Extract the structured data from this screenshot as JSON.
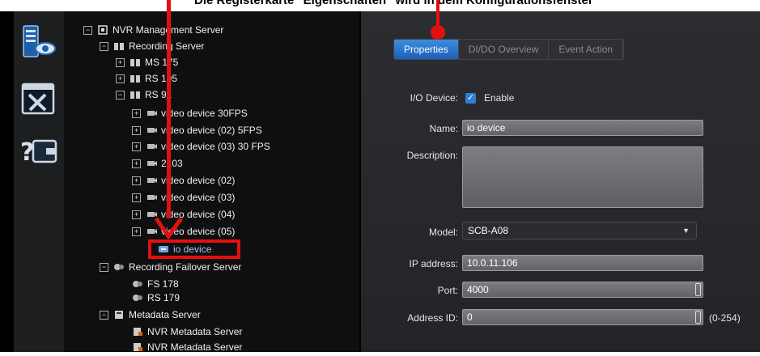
{
  "caption": "Die Registerkarte \"Eigenschaften\" wird in dem Konfigurationsfenster",
  "rail": {
    "icons": [
      "server-monitor-icon",
      "tools-window-icon",
      "help-wallet-icon"
    ]
  },
  "tree": {
    "items": [
      {
        "label": "NVR Management Server",
        "toggle": "⊟",
        "icon": "nvr-server-icon"
      },
      {
        "label": "Recording Server",
        "toggle": "⊟",
        "icon": "recording-server-icon"
      },
      {
        "label": "MS 175",
        "toggle": "⊞",
        "icon": "server-node-icon"
      },
      {
        "label": "RS 195",
        "toggle": "⊞",
        "icon": "server-node-icon"
      },
      {
        "label": "RS 91",
        "toggle": "⊟",
        "icon": "server-node-icon"
      },
      {
        "label": "video device 30FPS",
        "toggle": "⊞",
        "icon": "camera-icon"
      },
      {
        "label": "video device (02) 5FPS",
        "toggle": "⊞",
        "icon": "camera-icon"
      },
      {
        "label": "video device (03) 30 FPS",
        "toggle": "⊞",
        "icon": "camera-icon"
      },
      {
        "label": "2103",
        "toggle": "⊞",
        "icon": "camera-icon"
      },
      {
        "label": "video device (02)",
        "toggle": "⊞",
        "icon": "camera-icon"
      },
      {
        "label": "video device (03)",
        "toggle": "⊞",
        "icon": "camera-icon"
      },
      {
        "label": "video device (04)",
        "toggle": "⊞",
        "icon": "camera-icon"
      },
      {
        "label": "video device (05)",
        "toggle": "⊞",
        "icon": "camera-icon"
      },
      {
        "label": "io device",
        "toggle": "",
        "icon": "io-device-icon"
      },
      {
        "label": "Recording Failover Server",
        "toggle": "⊟",
        "icon": "failover-server-icon"
      },
      {
        "label": "FS 178",
        "toggle": "",
        "icon": "failover-node-icon"
      },
      {
        "label": "RS 179",
        "toggle": "",
        "icon": "failover-node-icon"
      },
      {
        "label": "Metadata Server",
        "toggle": "⊟",
        "icon": "metadata-server-icon"
      },
      {
        "label": "NVR Metadata Server",
        "toggle": "",
        "icon": "metadata-node-icon"
      },
      {
        "label": "NVR Metadata Server",
        "toggle": "",
        "icon": "metadata-node-icon"
      }
    ]
  },
  "tabs": [
    {
      "label": "Properties",
      "active": true
    },
    {
      "label": "DI/DO Overview",
      "active": false
    },
    {
      "label": "Event Action",
      "active": false
    }
  ],
  "form": {
    "io_device_label": "I/O Device:",
    "enable_label": "Enable",
    "enable_checked": true,
    "name_label": "Name:",
    "name_value": "io device",
    "description_label": "Description:",
    "description_value": "",
    "model_label": "Model:",
    "model_value": "SCB-A08",
    "ip_label": "IP address:",
    "ip_value": "10.0.11.106",
    "port_label": "Port:",
    "port_value": "4000",
    "address_label": "Address ID:",
    "address_value": "0",
    "address_range": "(0-254)"
  },
  "colors": {
    "accent": "#2f7fd6",
    "annotation": "#e31010",
    "tab_active": "#1d5fb8"
  }
}
